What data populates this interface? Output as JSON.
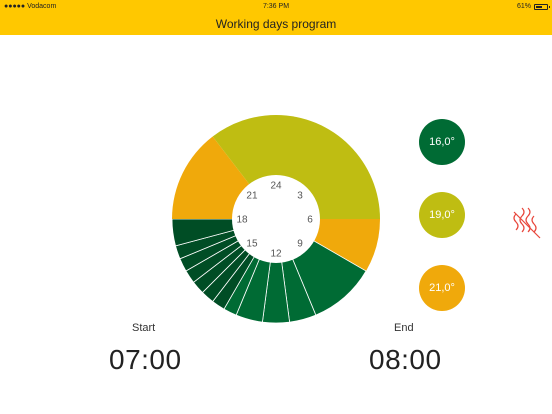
{
  "status_bar": {
    "carrier": "●●●●● Vodacom",
    "time": "7:36 PM",
    "battery": "61%",
    "battery_fraction": 0.61
  },
  "title": "Working days program",
  "dial": {
    "hour_labels": [
      {
        "label": "24",
        "hour": 0
      },
      {
        "label": "3",
        "hour": 3
      },
      {
        "label": "6",
        "hour": 6
      },
      {
        "label": "9",
        "hour": 9
      },
      {
        "label": "12",
        "hour": 12
      },
      {
        "label": "15",
        "hour": 15
      },
      {
        "label": "18",
        "hour": 18
      },
      {
        "label": "21",
        "hour": 21
      }
    ],
    "segments": [
      {
        "from": 0.0,
        "to": 6.0,
        "level": "19.0"
      },
      {
        "from": 6.0,
        "to": 8.0,
        "level": "21.0"
      },
      {
        "from": 8.0,
        "to": 10.5,
        "level": "16.0"
      },
      {
        "from": 10.5,
        "to": 11.5,
        "level": "16.0"
      },
      {
        "from": 11.5,
        "to": 12.5,
        "level": "16.0"
      },
      {
        "from": 12.5,
        "to": 13.5,
        "level": "16.0"
      },
      {
        "from": 13.5,
        "to": 14.0,
        "level": "16.0"
      },
      {
        "from": 14.0,
        "to": 14.5,
        "level": "16.0-dark"
      },
      {
        "from": 14.5,
        "to": 15.0,
        "level": "16.0-dark"
      },
      {
        "from": 15.0,
        "to": 15.5,
        "level": "16.0-dark"
      },
      {
        "from": 15.5,
        "to": 16.0,
        "level": "16.0-dark"
      },
      {
        "from": 16.0,
        "to": 16.5,
        "level": "16.0-dark"
      },
      {
        "from": 16.5,
        "to": 17.0,
        "level": "16.0-dark"
      },
      {
        "from": 17.0,
        "to": 18.0,
        "level": "16.0-dark"
      },
      {
        "from": 18.0,
        "to": 21.5,
        "level": "21.0"
      },
      {
        "from": 21.5,
        "to": 24.0,
        "level": "19.0"
      }
    ]
  },
  "temperatures": [
    {
      "label": "16,0°",
      "color": "#006b34"
    },
    {
      "label": "19,0°",
      "color": "#bfbd12"
    },
    {
      "label": "21,0°",
      "color": "#f0a90b"
    }
  ],
  "heater_icon": "heater-off-icon",
  "heater_color": "#e8473c",
  "level_colors": {
    "16.0": "#006b34",
    "16.0-dark": "#004d25",
    "19.0": "#bfbd12",
    "21.0": "#f0a90b"
  },
  "start": {
    "label": "Start",
    "time": "07:00"
  },
  "end": {
    "label": "End",
    "time": "08:00"
  }
}
